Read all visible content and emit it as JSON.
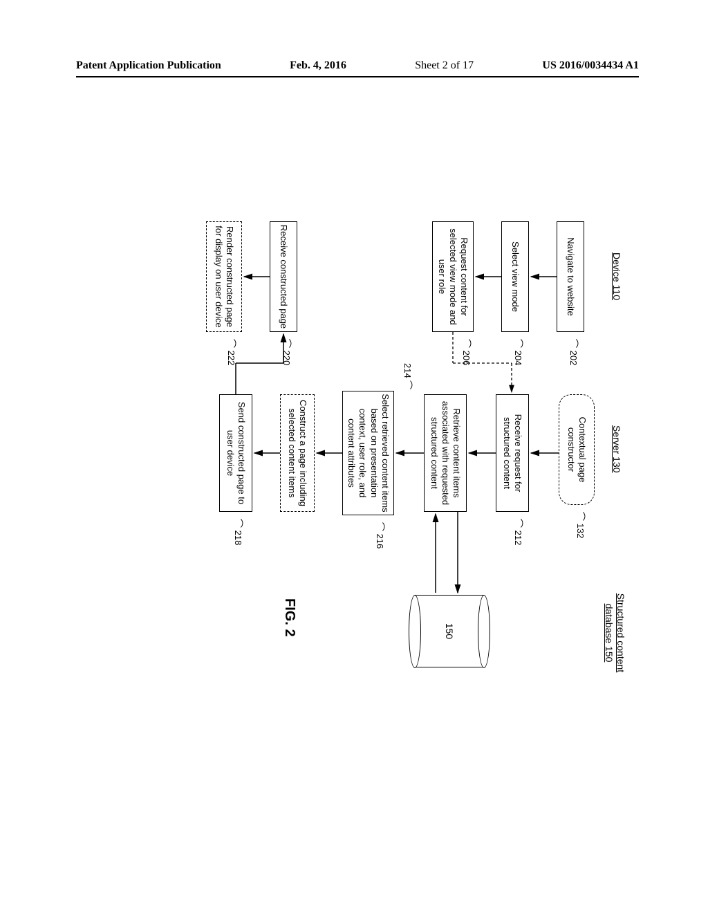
{
  "header": {
    "left": "Patent Application Publication",
    "date": "Feb. 4, 2016",
    "sheet": "Sheet 2 of 17",
    "pubno": "US 2016/0034434 A1"
  },
  "columns": {
    "device": "Device 110",
    "server": "Server 130",
    "database": "Structured content database 150"
  },
  "refs": {
    "r132": "132",
    "r150": "150",
    "r202": "202",
    "r204": "204",
    "r206": "206",
    "r212": "212",
    "r214": "214",
    "r216": "216",
    "r218": "218",
    "r220": "220",
    "r222": "222"
  },
  "nodes": {
    "constructor_box": "Contextual page constructor",
    "navigate": "Navigate to website",
    "select_mode": "Select view mode",
    "request_content": "Request content for selected view mode and user role",
    "receive_request": "Receive request for structured content",
    "retrieve_items": "Retrieve content items associated with requested structured content",
    "select_items": "Select retrieved content items based on presentation context, user role, and content attributes",
    "construct_page": "Construct a page including selected content items",
    "send_page": "Send constructed page to user device",
    "receive_page": "Receive constructed page",
    "render_page": "Render constructed page for display on user device"
  },
  "figure_label": "FIG. 2"
}
